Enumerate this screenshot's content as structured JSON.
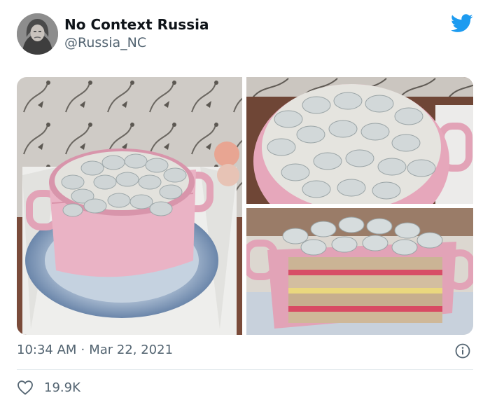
{
  "author": {
    "display_name": "No Context Russia",
    "handle": "@Russia_NC"
  },
  "icons": {
    "brand": "twitter-bird-icon",
    "info": "info-icon",
    "like": "heart-icon"
  },
  "colors": {
    "brand": "#1d9bf0",
    "secondary_text": "#536471",
    "divider": "#e6ecf0"
  },
  "media": {
    "photo_count": 3
  },
  "meta": {
    "time": "10:34 AM",
    "separator": "·",
    "date": "Mar 22, 2021"
  },
  "engagement": {
    "likes": "19.9K"
  }
}
